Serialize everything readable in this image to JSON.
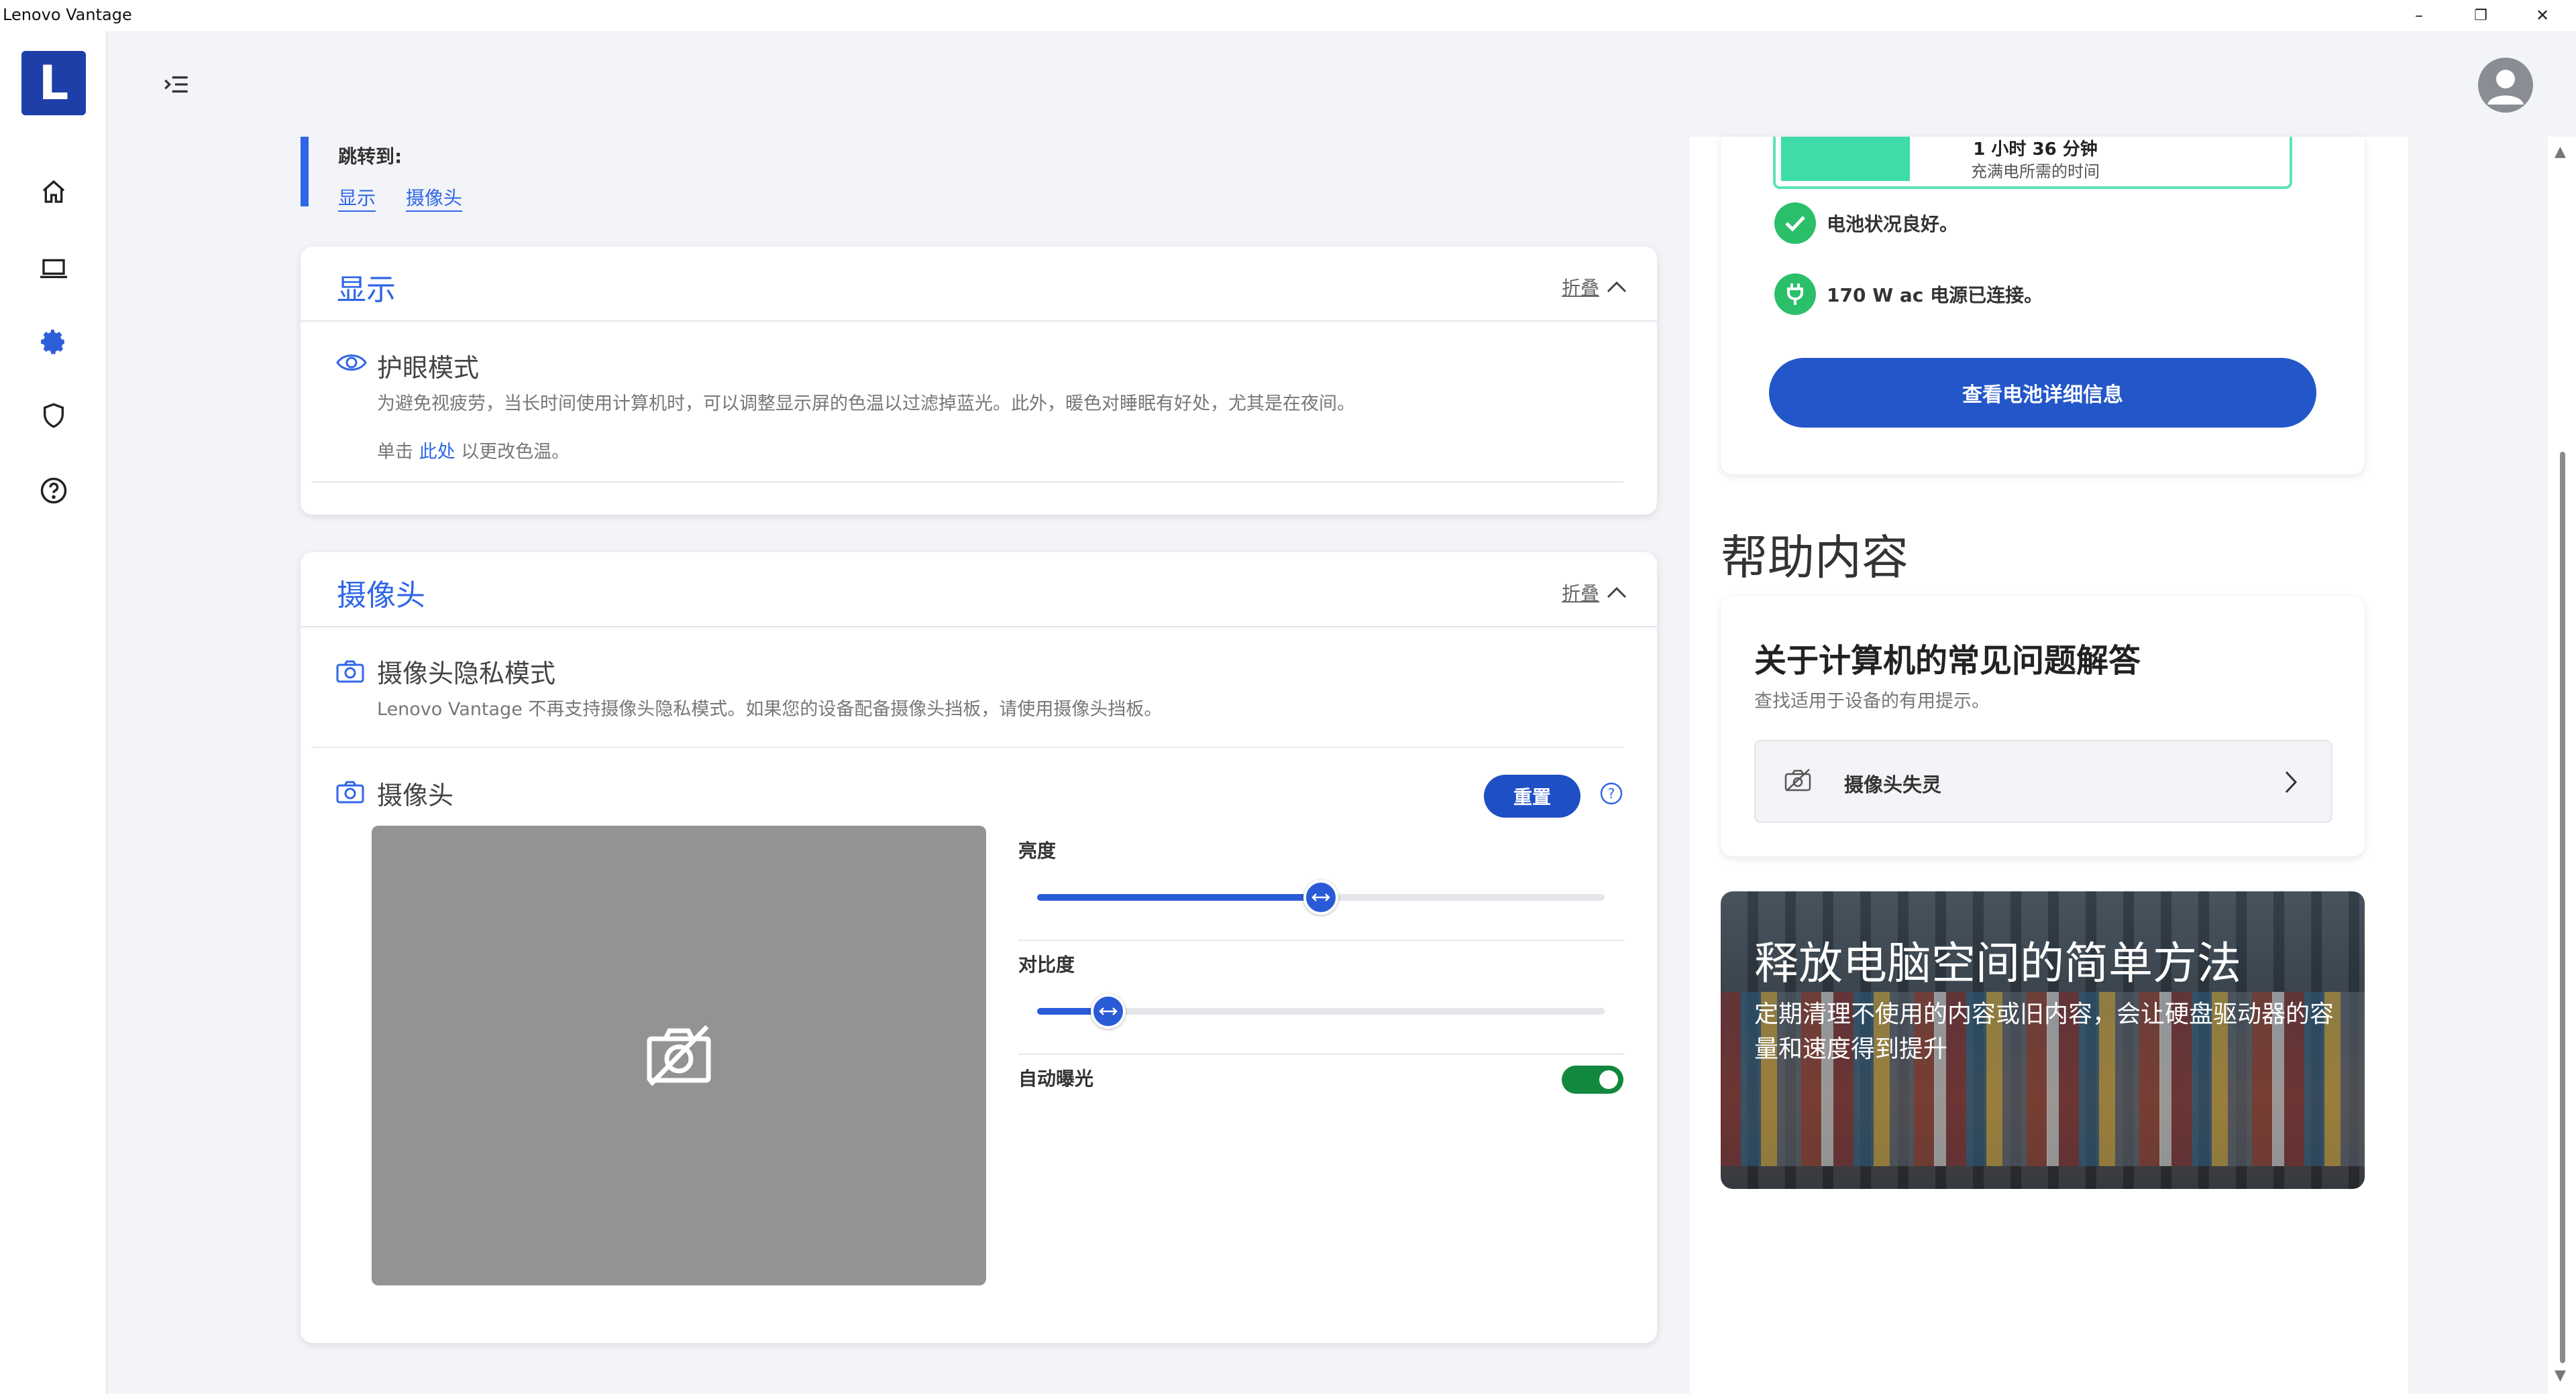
{
  "window": {
    "title": "Lenovo Vantage",
    "minimize": "–",
    "restore": "❐",
    "close": "✕"
  },
  "rail": {
    "logo_letter": "L"
  },
  "jump_to": {
    "label": "跳转到:",
    "links": [
      "显示",
      "摄像头"
    ]
  },
  "display_section": {
    "title": "显示",
    "collapse_label": "折叠",
    "eye_care": {
      "title": "护眼模式",
      "description": "为避免视疲劳，当长时间使用计算机时，可以调整显示屏的色温以过滤掉蓝光。此外，暖色对睡眠有好处，尤其是在夜间。",
      "hint_prefix": "单击",
      "hint_link": "此处",
      "hint_suffix": "以更改色温。"
    }
  },
  "camera_section": {
    "title": "摄像头",
    "collapse_label": "折叠",
    "privacy": {
      "title": "摄像头隐私模式",
      "description": "Lenovo Vantage 不再支持摄像头隐私模式。如果您的设备配备摄像头挡板，请使用摄像头挡板。"
    },
    "camera": {
      "title": "摄像头",
      "reset_label": "重置",
      "help_glyph": "?",
      "brightness": {
        "label": "亮度",
        "value": 0.5
      },
      "contrast": {
        "label": "对比度",
        "value": 0.125
      },
      "auto_exposure": {
        "label": "自动曝光",
        "on": true
      }
    }
  },
  "battery": {
    "charge_time": "1 小时 36 分钟",
    "charge_time_sub": "充满电所需的时间",
    "charge_level": 0.25,
    "status_good": "电池状况良好。",
    "ac_status": "170 W ac 电源已连接。",
    "details_button": "查看电池详细信息"
  },
  "help": {
    "heading": "帮助内容",
    "faq": {
      "title": "关于计算机的常见问题解答",
      "subtitle": "查找适用于设备的有用提示。",
      "item_label": "摄像头失灵"
    },
    "promo": {
      "title": "释放电脑空间的简单方法",
      "description": "定期清理不使用的内容或旧内容，会让硬盘驱动器的容量和速度得到提升"
    }
  },
  "colors": {
    "accent": "#2f66e8",
    "primary_button": "#2356c9",
    "toggle_on": "#12883e",
    "battery_fill": "#3ddca8"
  }
}
